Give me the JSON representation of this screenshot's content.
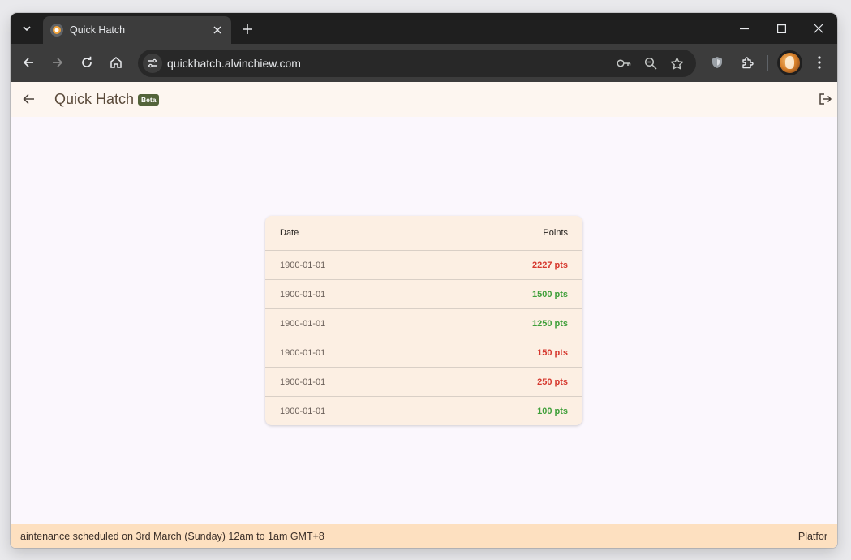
{
  "browser": {
    "tab_title": "Quick Hatch",
    "url": "quickhatch.alvinchiew.com"
  },
  "app": {
    "title": "Quick Hatch",
    "badge": "Beta"
  },
  "table": {
    "headers": {
      "date": "Date",
      "points": "Points"
    },
    "rows": [
      {
        "date": "1900-01-01",
        "points": "2227 pts",
        "status": "negative"
      },
      {
        "date": "1900-01-01",
        "points": "1500 pts",
        "status": "positive"
      },
      {
        "date": "1900-01-01",
        "points": "1250 pts",
        "status": "positive"
      },
      {
        "date": "1900-01-01",
        "points": "150 pts",
        "status": "negative"
      },
      {
        "date": "1900-01-01",
        "points": "250 pts",
        "status": "negative"
      },
      {
        "date": "1900-01-01",
        "points": "100 pts",
        "status": "positive"
      }
    ]
  },
  "banner": {
    "text": "aintenance scheduled on 3rd March (Sunday) 12am to 1am GMT+8",
    "right_text": "Platfor"
  },
  "colors": {
    "positive": "#3f9f3a",
    "negative": "#d6382e",
    "accent": "#53633a"
  }
}
